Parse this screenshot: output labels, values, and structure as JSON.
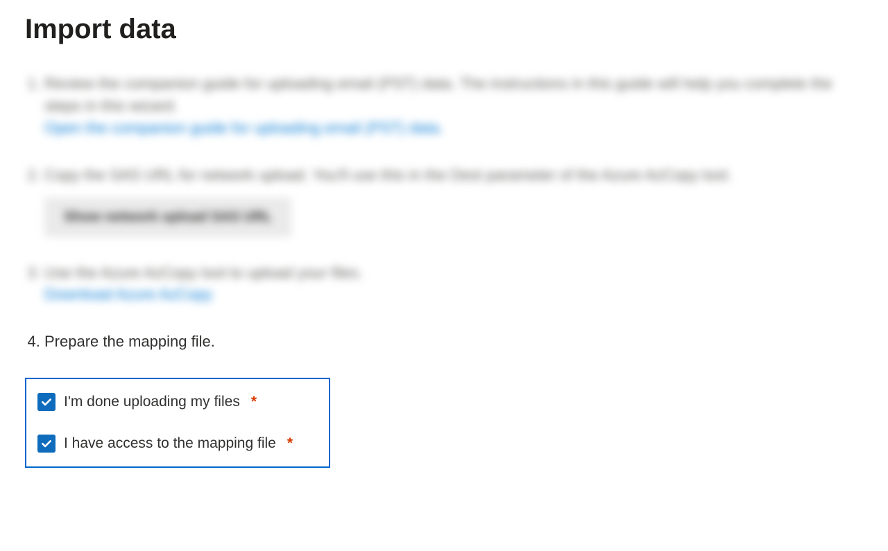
{
  "title": "Import data",
  "steps": {
    "s1": {
      "text": "Review the companion guide for uploading email (PST) data. The instructions in this guide will help you complete the steps in this wizard.",
      "link": "Open the companion guide for uploading email (PST) data."
    },
    "s2": {
      "text": "Copy the SAS URL for network upload. You'll use this in the Dest parameter of the Azure AzCopy tool.",
      "button": "Show network upload SAS URL"
    },
    "s3": {
      "text": "Use the Azure AzCopy tool to upload your files.",
      "link": "Download Azure AzCopy"
    },
    "s4": {
      "text": "Prepare the mapping file."
    }
  },
  "checkboxes": {
    "done_uploading": {
      "label": "I'm done uploading my files",
      "required_mark": "*",
      "checked": true
    },
    "have_mapping": {
      "label": "I have access to the mapping file",
      "required_mark": "*",
      "checked": true
    }
  }
}
